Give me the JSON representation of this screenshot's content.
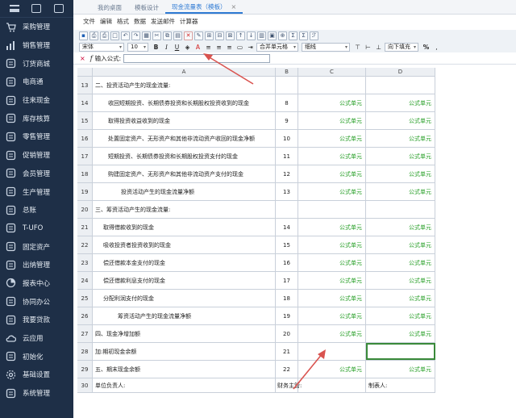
{
  "sidebar": {
    "items": [
      {
        "label": "采购管理",
        "icon": "cart-icon"
      },
      {
        "label": "销售管理",
        "icon": "chart-icon"
      },
      {
        "label": "订货商城",
        "icon": "shop-icon"
      },
      {
        "label": "电商通",
        "icon": "ecommerce-icon"
      },
      {
        "label": "往来现金",
        "icon": "exchange-icon"
      },
      {
        "label": "库存核算",
        "icon": "warehouse-icon"
      },
      {
        "label": "零售管理",
        "icon": "retail-icon"
      },
      {
        "label": "促销管理",
        "icon": "promotion-icon"
      },
      {
        "label": "会员管理",
        "icon": "member-icon"
      },
      {
        "label": "生产管理",
        "icon": "factory-icon"
      },
      {
        "label": "总账",
        "icon": "ledger-icon"
      },
      {
        "label": "T-UFO",
        "icon": "ufo-icon"
      },
      {
        "label": "固定资产",
        "icon": "bank-icon"
      },
      {
        "label": "出纳管理",
        "icon": "cashier-icon"
      },
      {
        "label": "报表中心",
        "icon": "pie-icon"
      },
      {
        "label": "协同办公",
        "icon": "collab-icon"
      },
      {
        "label": "我要贷款",
        "icon": "loan-icon"
      },
      {
        "label": "云应用",
        "icon": "cloud-icon"
      },
      {
        "label": "初始化",
        "icon": "init-icon"
      },
      {
        "label": "基础设置",
        "icon": "settings-icon"
      },
      {
        "label": "系统管理",
        "icon": "system-icon"
      }
    ]
  },
  "tabs": [
    {
      "label": "我的桌面",
      "active": false
    },
    {
      "label": "模板设计",
      "active": false
    },
    {
      "label": "现金流量表（模板）",
      "active": true
    }
  ],
  "menu": [
    "文件",
    "编辑",
    "格式",
    "数据",
    "发送邮件",
    "计算器"
  ],
  "toolbar2": {
    "font_family": "宋体",
    "font_size": "10",
    "bold": "B",
    "italic": "I",
    "underline": "U",
    "merge": "合并单元格",
    "border": "细线",
    "valign": "向下填充",
    "percent": "%"
  },
  "formula_bar": {
    "cancel": "×",
    "fx": "f",
    "label": "输入公式:",
    "value": ""
  },
  "grid": {
    "columns": [
      "A",
      "B",
      "C",
      "D"
    ],
    "rows": [
      {
        "n": "13",
        "a": "二、投资活动产生的现金流量:",
        "indent": 0,
        "b": "",
        "c": "",
        "d": ""
      },
      {
        "n": "14",
        "a": "收回短期投资、长期债券投资和长期股权投资收到的现金",
        "indent": 16,
        "b": "8",
        "c": "公式单元",
        "d": "公式单元"
      },
      {
        "n": "15",
        "a": "取得投资收益收到的现金",
        "indent": 16,
        "b": "9",
        "c": "公式单元",
        "d": "公式单元"
      },
      {
        "n": "16",
        "a": "处置固定资产、无形资产和其他非流动资产收回的现金净额",
        "indent": 16,
        "b": "10",
        "c": "公式单元",
        "d": "公式单元"
      },
      {
        "n": "17",
        "a": "短期投资、长期债券投资和长期股权投资支付的现金",
        "indent": 16,
        "b": "11",
        "c": "公式单元",
        "d": "公式单元"
      },
      {
        "n": "18",
        "a": "购建固定资产、无形资产和其他非流动资产支付的现金",
        "indent": 16,
        "b": "12",
        "c": "公式单元",
        "d": "公式单元"
      },
      {
        "n": "19",
        "a": "投资活动产生的现金流量净额",
        "indent": 32,
        "b": "13",
        "c": "公式单元",
        "d": "公式单元"
      },
      {
        "n": "20",
        "a": "三、筹资活动产生的现金流量:",
        "indent": 0,
        "b": "",
        "c": "",
        "d": ""
      },
      {
        "n": "21",
        "a": "取得借款收到的现金",
        "indent": 10,
        "b": "14",
        "c": "公式单元",
        "d": "公式单元"
      },
      {
        "n": "22",
        "a": "吸收投资者投资收到的现金",
        "indent": 10,
        "b": "15",
        "c": "公式单元",
        "d": "公式单元"
      },
      {
        "n": "23",
        "a": "偿还借款本金支付的现金",
        "indent": 10,
        "b": "16",
        "c": "公式单元",
        "d": "公式单元"
      },
      {
        "n": "24",
        "a": "偿还借款利息支付的现金",
        "indent": 10,
        "b": "17",
        "c": "公式单元",
        "d": "公式单元"
      },
      {
        "n": "25",
        "a": "分配利润支付的现金",
        "indent": 10,
        "b": "18",
        "c": "公式单元",
        "d": "公式单元"
      },
      {
        "n": "26",
        "a": "筹资活动产生的现金流量净额",
        "indent": 28,
        "b": "19",
        "c": "公式单元",
        "d": "公式单元"
      },
      {
        "n": "27",
        "a": "四、现金净增加额",
        "indent": 0,
        "b": "20",
        "c": "公式单元",
        "d": "公式单元"
      },
      {
        "n": "28",
        "a": "加:期初现金余额",
        "indent": 0,
        "b": "21",
        "c": "",
        "d": "",
        "selected": true
      },
      {
        "n": "29",
        "a": "五、期末现金余额",
        "indent": 0,
        "b": "22",
        "c": "公式单元",
        "d": "公式单元"
      },
      {
        "n": "30",
        "a": "单位负责人:",
        "indent": 0,
        "b": "财务主管:",
        "c": "",
        "d": "制表人:",
        "footer": true
      }
    ]
  },
  "colors": {
    "sidebar_bg": "#1e2f47",
    "formula_cell": "#2aa02a",
    "active_tab": "#2f7ad3",
    "arrow": "#d9534f"
  }
}
